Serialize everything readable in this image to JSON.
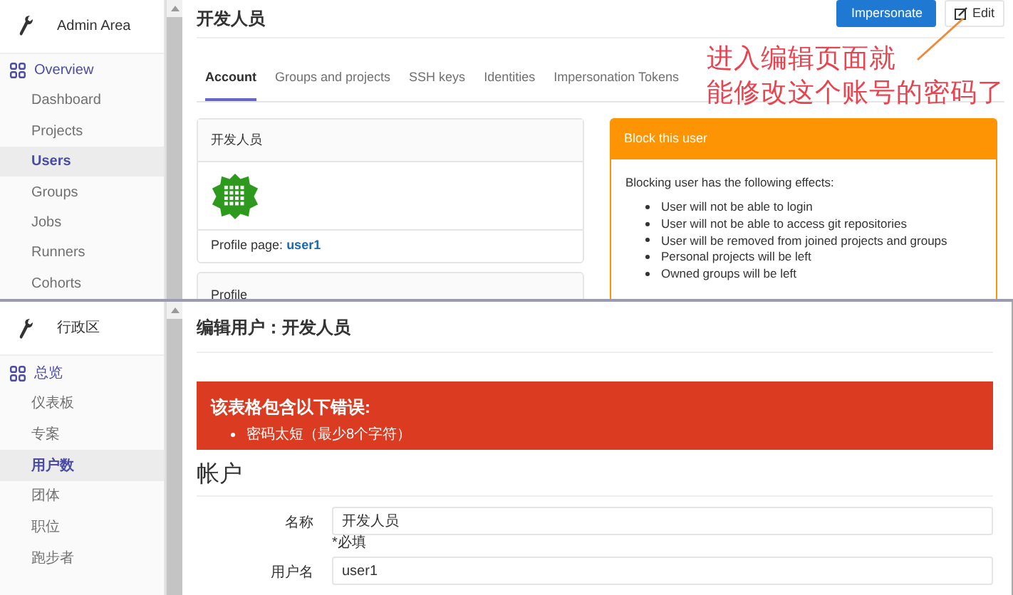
{
  "profile_view": {
    "sidebar": {
      "title": "Admin Area",
      "section": "Overview",
      "items": [
        {
          "label": "Dashboard",
          "selected": false
        },
        {
          "label": "Projects",
          "selected": false
        },
        {
          "label": "Users",
          "selected": true
        },
        {
          "label": "Groups",
          "selected": false
        },
        {
          "label": "Jobs",
          "selected": false
        },
        {
          "label": "Runners",
          "selected": false
        },
        {
          "label": "Cohorts",
          "selected": false
        }
      ]
    },
    "title": "开发人员",
    "buttons": {
      "impersonate": "Impersonate",
      "edit": "Edit"
    },
    "annotation": [
      "进入编辑页面就",
      "能修改这个账号的密码了"
    ],
    "tabs": [
      {
        "label": "Account",
        "selected": true
      },
      {
        "label": "Groups and projects",
        "selected": false
      },
      {
        "label": "SSH keys",
        "selected": false
      },
      {
        "label": "Identities",
        "selected": false
      },
      {
        "label": "Impersonation Tokens",
        "selected": false
      }
    ],
    "user_card": {
      "name": "开发人员",
      "profile_label": "Profile page:",
      "profile_link": "user1"
    },
    "next_card_title": "Profile",
    "block_card": {
      "title": "Block this user",
      "intro": "Blocking user has the following effects:",
      "effects": [
        "User will not be able to login",
        "User will not be able to access git repositories",
        "User will be removed from joined projects and groups",
        "Personal projects will be left",
        "Owned groups will be left"
      ]
    }
  },
  "edit_view": {
    "sidebar": {
      "title": "行政区",
      "section": "总览",
      "items": [
        {
          "label": "仪表板",
          "selected": false
        },
        {
          "label": "专案",
          "selected": false
        },
        {
          "label": "用户数",
          "selected": true
        },
        {
          "label": "团体",
          "selected": false
        },
        {
          "label": "职位",
          "selected": false
        },
        {
          "label": "跑步者",
          "selected": false
        }
      ]
    },
    "title": "编辑用户：开发人员",
    "error": {
      "title": "该表格包含以下错误:",
      "items": [
        "密码太短（最少8个字符）"
      ]
    },
    "section": "帐户",
    "fields": [
      {
        "label": "名称",
        "value": "开发人员",
        "hint": "*必填"
      },
      {
        "label": "用户名",
        "value": "user1"
      }
    ]
  }
}
